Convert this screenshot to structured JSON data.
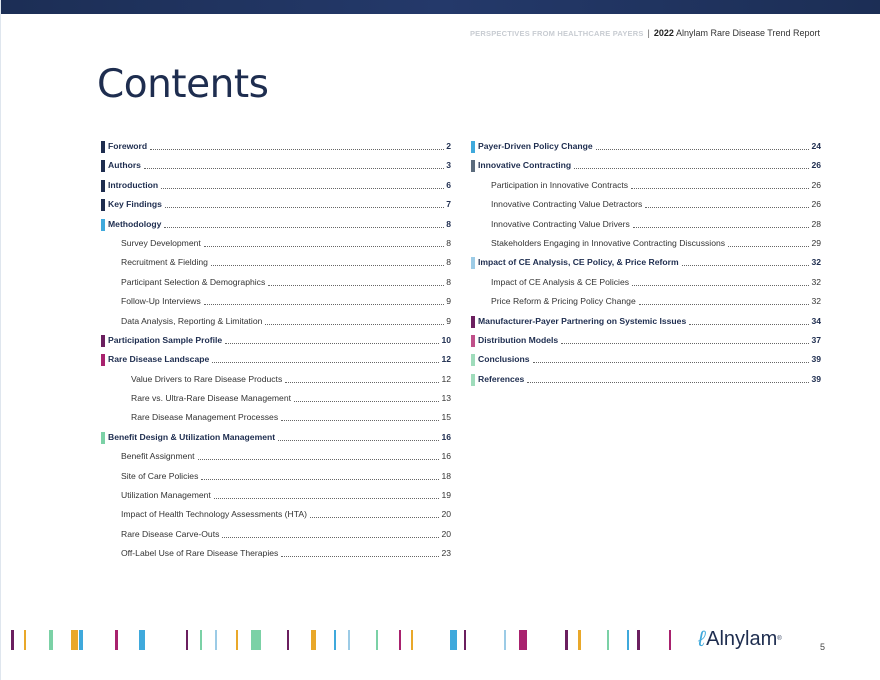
{
  "header": {
    "kicker": "PERSPECTIVES FROM HEALTHCARE PAYERS",
    "separator": "|",
    "year": "2022",
    "report": "Alnylam Rare Disease Trend Report"
  },
  "title": "Contents",
  "colors": {
    "navy": "#1e2d4f",
    "blue": "#3fa9dc",
    "purple": "#6b1f5f",
    "magenta": "#a8226e",
    "green": "#7bd1a6",
    "lightblue": "#9ccbe6",
    "grey": "#5b6b7d",
    "orange": "#e9a82a"
  },
  "left": [
    {
      "label": "Foreword",
      "page": "2",
      "level": "main",
      "color": "#1e2d4f"
    },
    {
      "label": "Authors",
      "page": "3",
      "level": "main",
      "color": "#1e2d4f"
    },
    {
      "label": "Introduction",
      "page": "6",
      "level": "main",
      "color": "#1e2d4f"
    },
    {
      "label": "Key Findings",
      "page": "7",
      "level": "main",
      "color": "#1e2d4f"
    },
    {
      "label": "Methodology",
      "page": "8",
      "level": "main",
      "color": "#3fa9dc"
    },
    {
      "label": "Survey Development",
      "page": "8",
      "level": "sub"
    },
    {
      "label": "Recruitment & Fielding",
      "page": "8",
      "level": "sub"
    },
    {
      "label": "Participant Selection & Demographics",
      "page": "8",
      "level": "sub"
    },
    {
      "label": "Follow-Up Interviews",
      "page": "9",
      "level": "sub"
    },
    {
      "label": "Data Analysis, Reporting & Limitation",
      "page": "9",
      "level": "sub"
    },
    {
      "label": "Participation Sample Profile",
      "page": "10",
      "level": "main",
      "color": "#6b1f5f"
    },
    {
      "label": "Rare Disease Landscape",
      "page": "12",
      "level": "main",
      "color": "#a8226e"
    },
    {
      "label": "Value Drivers to Rare Disease Products",
      "page": "12",
      "level": "sub2"
    },
    {
      "label": "Rare vs. Ultra-Rare Disease Management",
      "page": "13",
      "level": "sub2"
    },
    {
      "label": "Rare Disease Management Processes",
      "page": "15",
      "level": "sub2"
    },
    {
      "label": "Benefit Design & Utilization Management",
      "page": "16",
      "level": "main",
      "color": "#7bd1a6"
    },
    {
      "label": "Benefit Assignment",
      "page": "16",
      "level": "sub"
    },
    {
      "label": "Site of Care Policies",
      "page": "18",
      "level": "sub"
    },
    {
      "label": "Utilization Management",
      "page": "19",
      "level": "sub"
    },
    {
      "label": "Impact of Health Technology Assessments (HTA)",
      "page": "20",
      "level": "sub"
    },
    {
      "label": "Rare Disease Carve-Outs",
      "page": "20",
      "level": "sub"
    },
    {
      "label": "Off-Label Use of Rare Disease Therapies",
      "page": "23",
      "level": "sub"
    }
  ],
  "right": [
    {
      "label": "Payer-Driven Policy Change",
      "page": "24",
      "level": "main",
      "color": "#3fa9dc"
    },
    {
      "label": "Innovative Contracting",
      "page": "26",
      "level": "main",
      "color": "#5b6b7d"
    },
    {
      "label": "Participation in Innovative Contracts",
      "page": "26",
      "level": "sub"
    },
    {
      "label": "Innovative Contracting Value Detractors",
      "page": "26",
      "level": "sub"
    },
    {
      "label": "Innovative Contracting Value Drivers",
      "page": "28",
      "level": "sub"
    },
    {
      "label": "Stakeholders Engaging in Innovative Contracting Discussions",
      "page": "29",
      "level": "sub"
    },
    {
      "label": "Impact of CE Analysis, CE Policy, & Price Reform",
      "page": "32",
      "level": "main",
      "color": "#9ccbe6"
    },
    {
      "label": "Impact of CE Analysis & CE Policies",
      "page": "32",
      "level": "sub"
    },
    {
      "label": "Price Reform & Pricing Policy Change",
      "page": "32",
      "level": "sub"
    },
    {
      "label": "Manufacturer-Payer Partnering on Systemic Issues",
      "page": "34",
      "level": "main",
      "color": "#6b1f5f"
    },
    {
      "label": "Distribution Models",
      "page": "37",
      "level": "main",
      "color": "#c0508a"
    },
    {
      "label": "Conclusions",
      "page": "39",
      "level": "main",
      "color": "#9fdcbb"
    },
    {
      "label": "References",
      "page": "39",
      "level": "main",
      "color": "#9fdcbb"
    }
  ],
  "footer": {
    "logo_text": "Alnylam",
    "page": "5"
  }
}
